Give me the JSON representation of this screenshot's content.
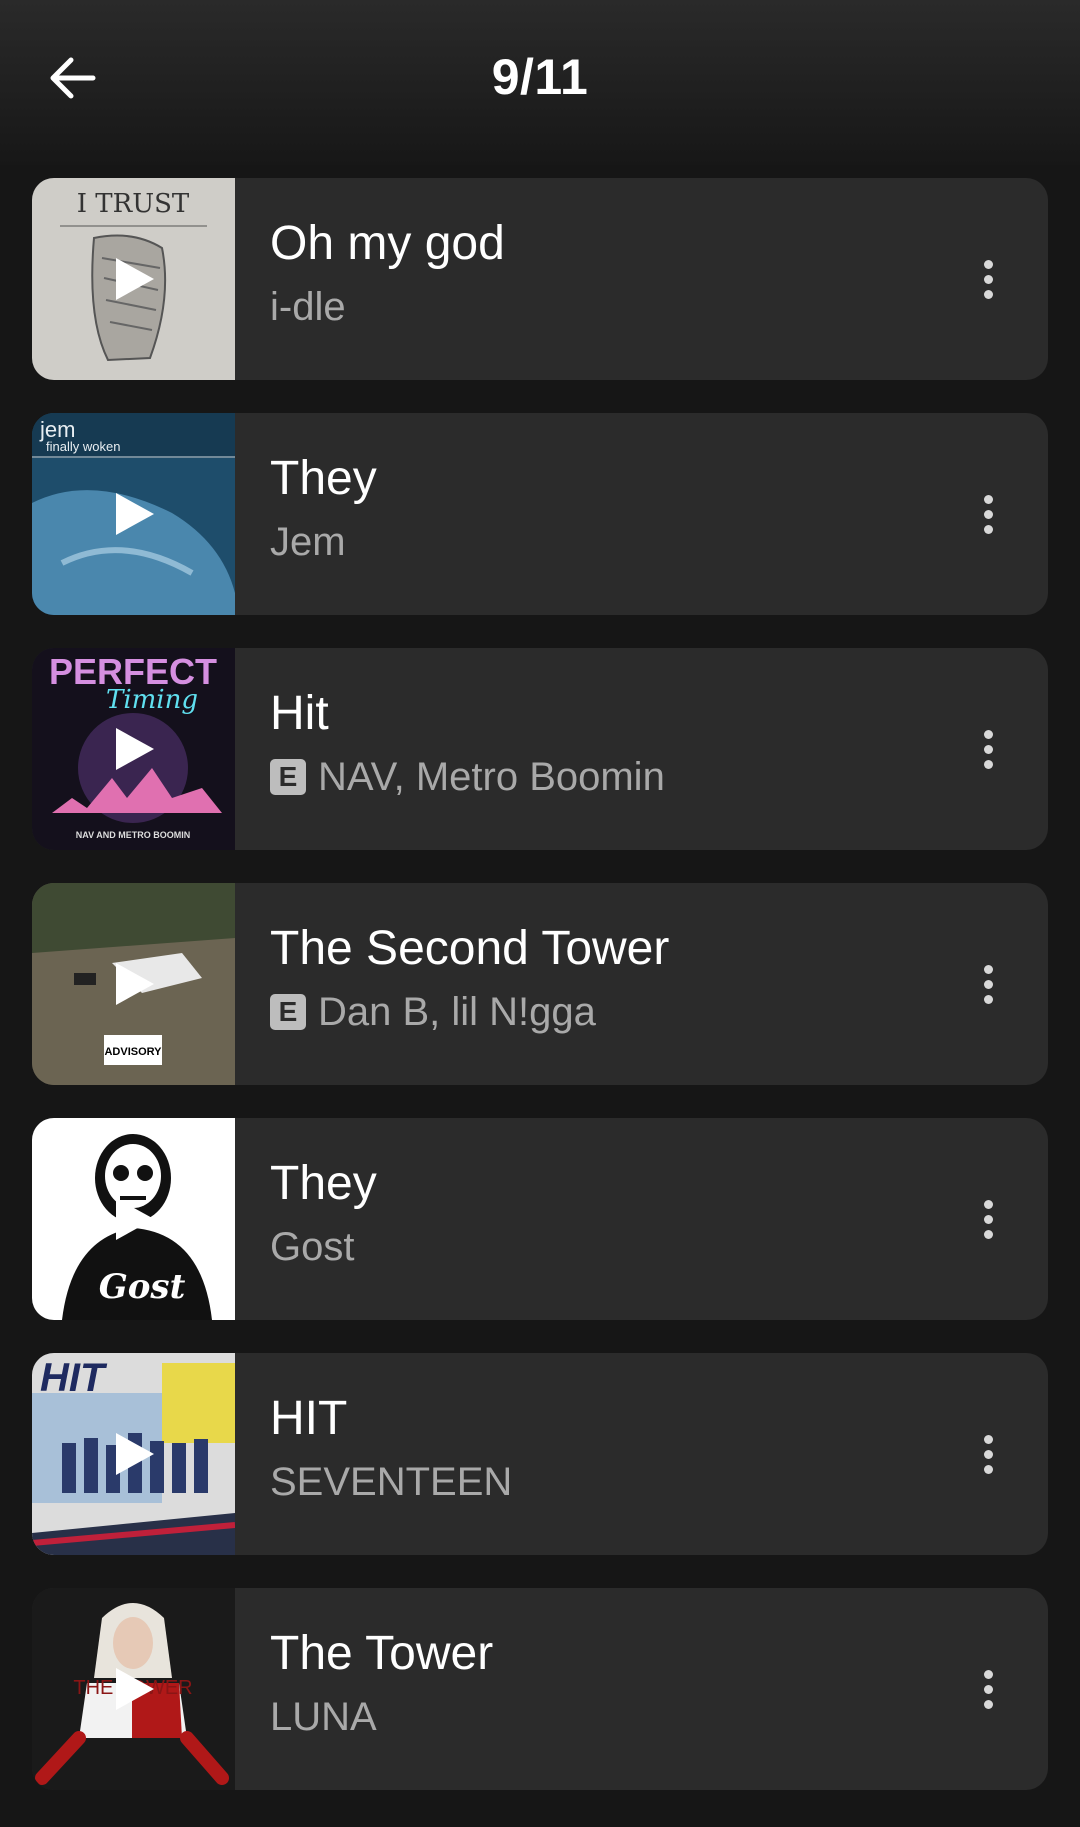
{
  "header": {
    "counter": "9/11"
  },
  "tracks": [
    {
      "title": "Oh my god",
      "artist": "i-dle",
      "explicit": false,
      "art_text": "I TRUST"
    },
    {
      "title": "They",
      "artist": "Jem",
      "explicit": false,
      "art_text": "jem",
      "art_sub": "finally woken"
    },
    {
      "title": "Hit",
      "artist": "NAV, Metro Boomin",
      "explicit": true,
      "art_text": "PERFECT",
      "art_sub": "Timing",
      "art_foot": "NAV AND METRO BOOMIN"
    },
    {
      "title": "The Second Tower",
      "artist": "Dan B, lil N!gga",
      "explicit": true,
      "art_text": "ADVISORY"
    },
    {
      "title": "They",
      "artist": "Gost",
      "explicit": false,
      "art_text": "Gost"
    },
    {
      "title": "HIT",
      "artist": "SEVENTEEN",
      "explicit": false,
      "art_text": "HIT"
    },
    {
      "title": "The Tower",
      "artist": "LUNA",
      "explicit": false,
      "art_text": "THE TOWER"
    }
  ],
  "explicit_label": "E",
  "colors": {
    "background": "#161616",
    "card": "#2b2b2b",
    "subtitle": "#a9a9a9"
  }
}
